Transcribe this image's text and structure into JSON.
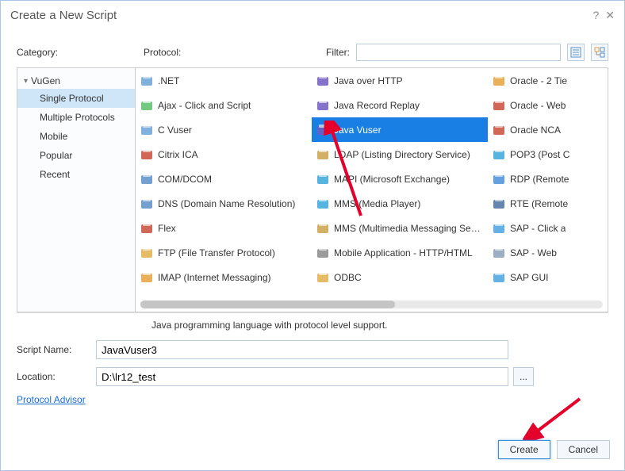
{
  "title": "Create a New Script",
  "labels": {
    "category": "Category:",
    "protocol": "Protocol:",
    "filter": "Filter:"
  },
  "filter": {
    "value": ""
  },
  "tree": {
    "root": "VuGen",
    "items": [
      "Single Protocol",
      "Multiple Protocols",
      "Mobile",
      "Popular",
      "Recent"
    ],
    "selected_index": 0
  },
  "protocols": {
    "col1": [
      ".NET",
      "Ajax - Click and Script",
      "C Vuser",
      "Citrix ICA",
      "COM/DCOM",
      "DNS (Domain Name Resolution)",
      "Flex",
      "FTP (File Transfer Protocol)",
      "IMAP (Internet Messaging)"
    ],
    "col2": [
      "Java over HTTP",
      "Java Record Replay",
      "Java Vuser",
      "LDAP (Listing Directory Service)",
      "MAPI (Microsoft Exchange)",
      "MMS (Media Player)",
      "MMS (Multimedia Messaging Service)",
      "Mobile Application - HTTP/HTML",
      "ODBC"
    ],
    "col3": [
      "Oracle - 2 Tie",
      "Oracle - Web",
      "Oracle NCA",
      "POP3 (Post C",
      "RDP (Remote",
      "RTE (Remote",
      "SAP - Click a",
      "SAP - Web",
      "SAP GUI"
    ],
    "col1_icons": [
      "#6aa2d8",
      "#5bbf6a",
      "#6aa2d8",
      "#c94c3a",
      "#5a8fc9",
      "#5a8fc9",
      "#c94c3a",
      "#e0b04a",
      "#e6a23c"
    ],
    "col2_icons": [
      "#6f5bbf",
      "#6f5bbf",
      "#6f5bbf",
      "#caa24a",
      "#3aa7d8",
      "#3aa7d8",
      "#caa24a",
      "#888888",
      "#e0b04a"
    ],
    "col3_icons": [
      "#e6a23c",
      "#c94c3a",
      "#c94c3a",
      "#3aa7d8",
      "#4a90d8",
      "#4a6fa0",
      "#4aa3e0",
      "#8aa0b8",
      "#4aa3e0"
    ],
    "selected": {
      "col": 2,
      "index": 2
    }
  },
  "description": "Java programming language with protocol level support.",
  "form": {
    "script_name_label": "Script Name:",
    "script_name_value": "JavaVuser3",
    "location_label": "Location:",
    "location_value": "D:\\lr12_test",
    "browse_label": "...",
    "advisor_link": "Protocol Advisor"
  },
  "buttons": {
    "create": "Create",
    "cancel": "Cancel"
  }
}
